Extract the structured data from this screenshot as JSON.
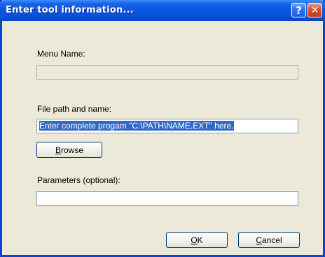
{
  "window": {
    "title": "Enter tool information...",
    "help_glyph": "?",
    "close_glyph": "✕"
  },
  "menu_name": {
    "label": "Menu Name:",
    "value": ""
  },
  "file_path": {
    "label": "File path and name:",
    "value": "Enter complete progam \"C:\\PATH\\NAME.EXT\" here."
  },
  "browse": {
    "mnemonic": "B",
    "rest": "rowse"
  },
  "parameters": {
    "label": "Parameters (optional):",
    "value": ""
  },
  "ok": {
    "mnemonic": "O",
    "rest": "K"
  },
  "cancel": {
    "mnemonic": "C",
    "rest": "ancel"
  },
  "colors": {
    "titlebar": "#0a55e0",
    "dialog_bg": "#ece9d8",
    "selection": "#316ac5"
  }
}
